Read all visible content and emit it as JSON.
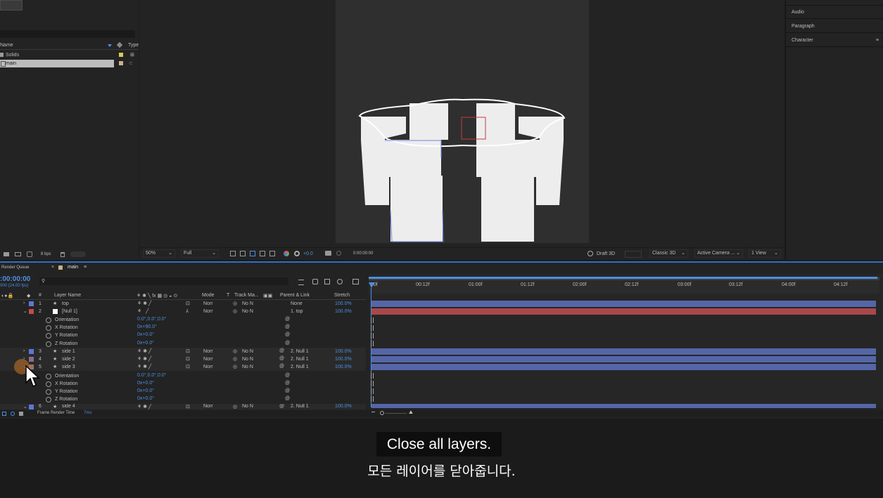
{
  "project": {
    "header_name": "Name",
    "header_type": "Type",
    "items": [
      {
        "label": "Solids"
      },
      {
        "label": "main"
      }
    ],
    "bpc": "8 bpc"
  },
  "viewer": {
    "zoom": "50%",
    "resolution": "Full",
    "exposure": "+0.0",
    "timecode": "0:00:00:00",
    "renderer_badge": "Draft 3D",
    "renderer": "Classic 3D",
    "camera": "Active Camera ...",
    "views": "1 View"
  },
  "right_panels": [
    "Audio",
    "Paragraph",
    "Character"
  ],
  "timeline": {
    "tab_render_queue": "Render Queue",
    "tab_comp": "main",
    "timecode": ":00:00:00",
    "fps": "000 (24.00 fps)",
    "headers": {
      "num": "#",
      "layer_name": "Layer Name",
      "mode": "Mode",
      "t": "T",
      "track_matte": "Track Ma...",
      "parent": "Parent & Link",
      "stretch": "Stretch"
    },
    "ruler_ticks": [
      "00f",
      "00:12f",
      "01:00f",
      "01:12f",
      "02:00f",
      "02:12f",
      "03:00f",
      "03:12f",
      "04:00f",
      "04:12f"
    ],
    "layers": [
      {
        "num": "1",
        "name": "top",
        "mode": "Norr",
        "matte": "No N",
        "parent": "None",
        "stretch": "100.0%"
      },
      {
        "num": "2",
        "name": "[Null 1]",
        "mode": "Norr",
        "matte": "No N",
        "parent": "1. top",
        "stretch": "100.0%"
      },
      {
        "num": "3",
        "name": "side 1",
        "mode": "Norr",
        "matte": "No N",
        "parent": "2. Null 1",
        "stretch": "100.0%"
      },
      {
        "num": "4",
        "name": "side 2",
        "mode": "Norr",
        "matte": "No N",
        "parent": "2. Null 1",
        "stretch": "100.0%"
      },
      {
        "num": "5",
        "name": "side 3",
        "mode": "Norr",
        "matte": "No N",
        "parent": "2. Null 1",
        "stretch": "100.0%"
      },
      {
        "num": "6",
        "name": "side 4",
        "mode": "Norr",
        "matte": "No N",
        "parent": "2. Null 1",
        "stretch": "100.0%"
      }
    ],
    "null_props": [
      {
        "name": "Orientation",
        "value": "0.0°,0.0°,0.0°"
      },
      {
        "name": "X Rotation",
        "value": "0x+90.0°"
      },
      {
        "name": "Y Rotation",
        "value": "0x+0.0°"
      },
      {
        "name": "Z Rotation",
        "value": "0x+0.0°"
      }
    ],
    "side3_props": [
      {
        "name": "Orientation",
        "value": "0.0°,0.0°,0.0°"
      },
      {
        "name": "X Rotation",
        "value": "0x+0.0°"
      },
      {
        "name": "Y Rotation",
        "value": "0x+0.0°"
      },
      {
        "name": "Z Rotation",
        "value": "0x+0.0°"
      }
    ],
    "frame_render_label": "Frame Render Time",
    "frame_render_value": "7ms"
  },
  "subtitles": {
    "english": "Close all layers.",
    "korean": "모든 레이어를 닫아줍니다."
  },
  "colors": {
    "accent": "#2d6fc9",
    "layer_bar": "#5566a8",
    "null_bar": "#a9484a"
  }
}
